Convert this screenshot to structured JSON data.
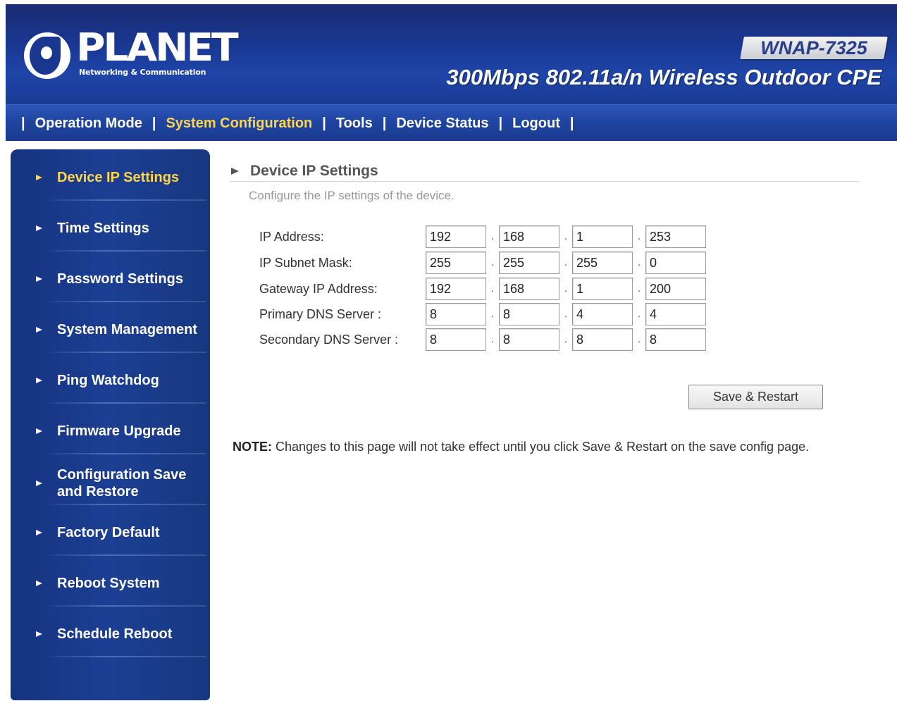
{
  "brand": {
    "logo_text": "PLANET",
    "logo_subtitle": "Networking & Communication",
    "model": "WNAP-7325",
    "product_title": "300Mbps 802.11a/n Wireless Outdoor CPE"
  },
  "topnav": {
    "items": [
      {
        "label": "Operation Mode",
        "active": false
      },
      {
        "label": "System Configuration",
        "active": true
      },
      {
        "label": "Tools",
        "active": false
      },
      {
        "label": "Device Status",
        "active": false
      },
      {
        "label": "Logout",
        "active": false
      }
    ],
    "separator": "|"
  },
  "sidebar": {
    "items": [
      {
        "label": "Device IP Settings",
        "active": true
      },
      {
        "label": "Time Settings"
      },
      {
        "label": "Password Settings"
      },
      {
        "label": "System Management"
      },
      {
        "label": "Ping Watchdog"
      },
      {
        "label": "Firmware Upgrade"
      },
      {
        "label_line1": "Configuration Save",
        "label_line2": "and Restore"
      },
      {
        "label": "Factory Default"
      },
      {
        "label": "Reboot System"
      },
      {
        "label": "Schedule Reboot"
      }
    ]
  },
  "main": {
    "title": "Device IP Settings",
    "description": "Configure the IP settings of the device.",
    "fields": [
      {
        "label": "IP Address:",
        "octets": [
          "192",
          "168",
          "1",
          "253"
        ]
      },
      {
        "label": "IP Subnet Mask:",
        "octets": [
          "255",
          "255",
          "255",
          "0"
        ]
      },
      {
        "label": "Gateway IP Address:",
        "octets": [
          "192",
          "168",
          "1",
          "200"
        ]
      },
      {
        "label": "Primary DNS Server :",
        "octets": [
          "8",
          "8",
          "4",
          "4"
        ]
      },
      {
        "label": "Secondary DNS Server :",
        "octets": [
          "8",
          "8",
          "8",
          "8"
        ]
      }
    ],
    "dot": ".",
    "save_button": "Save & Restart",
    "note_label": "NOTE:",
    "note_text": " Changes to this page will not take effect until you click Save & Restart on the save config page."
  },
  "colors": {
    "banner": "#1a3a96",
    "active_text": "#ffd54a",
    "sidebar": "#1c3f93"
  }
}
